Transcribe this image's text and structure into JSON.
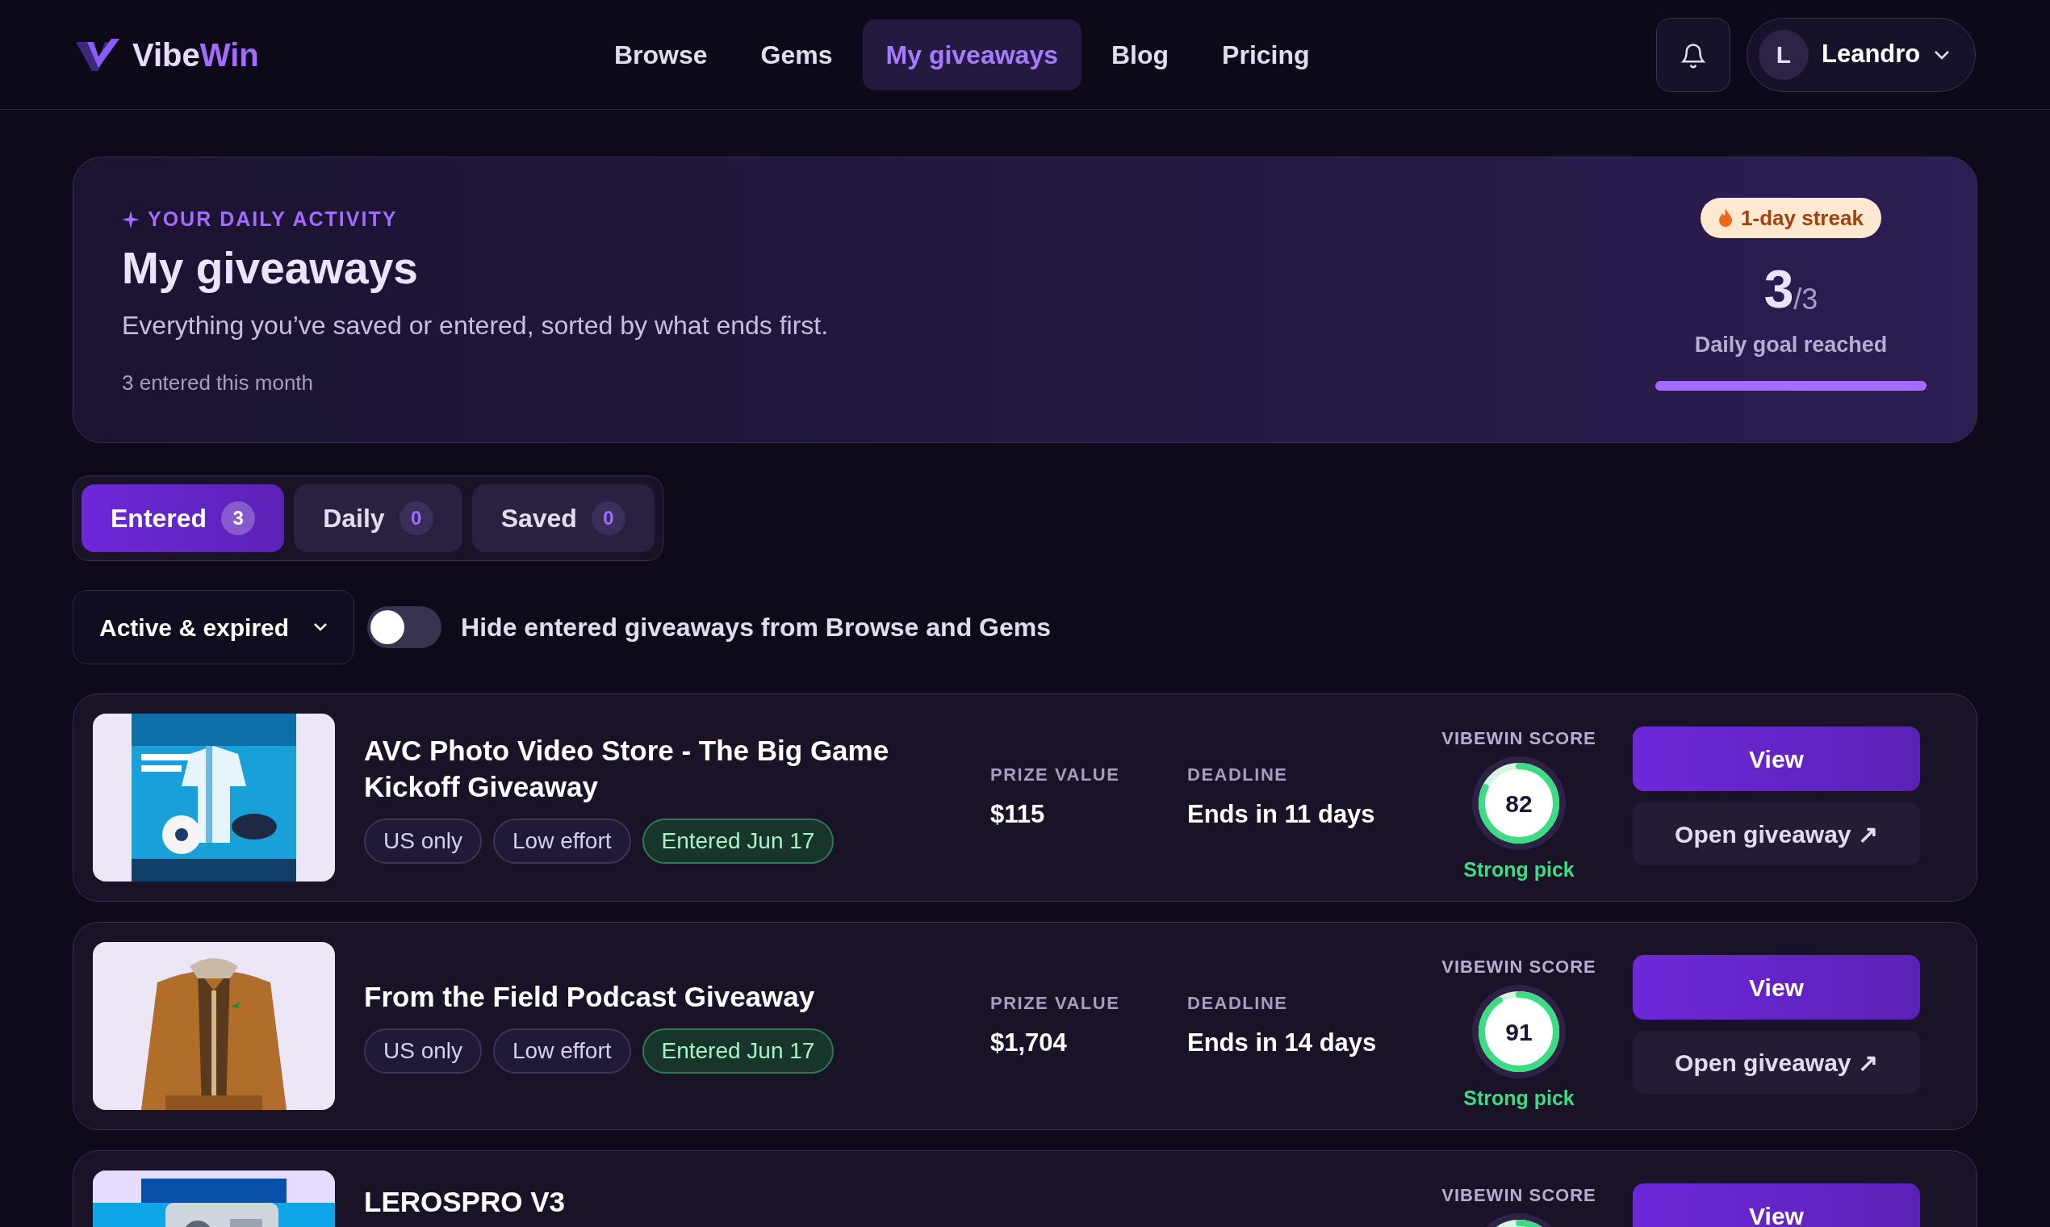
{
  "brand": {
    "part1": "Vibe",
    "part2": "Win"
  },
  "nav": [
    {
      "label": "Browse",
      "selected": false
    },
    {
      "label": "Gems",
      "selected": false
    },
    {
      "label": "My giveaways",
      "selected": true
    },
    {
      "label": "Blog",
      "selected": false
    },
    {
      "label": "Pricing",
      "selected": false
    }
  ],
  "user": {
    "initial": "L",
    "name": "Leandro"
  },
  "hero": {
    "eyebrow": "YOUR DAILY ACTIVITY",
    "title": "My giveaways",
    "subtitle": "Everything you’ve saved or entered, sorted by what ends first.",
    "note": "3 entered this month",
    "streak": "1-day streak",
    "goal_count": "3",
    "goal_total": "/3",
    "goal_label": "Daily goal reached",
    "level": 1
  },
  "tabs": [
    {
      "label": "Entered",
      "count": "3",
      "selected": true
    },
    {
      "label": "Daily",
      "count": "0",
      "selected": false
    },
    {
      "label": "Saved",
      "count": "0",
      "selected": false
    }
  ],
  "filter": {
    "value": "Active & expired"
  },
  "hide_toggle": {
    "on": false,
    "label": "Hide entered giveaways from Browse and Gems"
  },
  "giveaways": [
    {
      "title": "AVC Photo Video Store - The Big Game Kickoff Giveaway",
      "tags": [
        {
          "label": "US only",
          "kind": "plain"
        },
        {
          "label": "Low effort",
          "kind": "plain"
        },
        {
          "label": "Entered Jun 17",
          "kind": "entered"
        }
      ],
      "prize_label": "PRIZE VALUE",
      "prize": "$115",
      "deadline_label": "DEADLINE",
      "deadline": "Ends in 11 days",
      "score_label": "VIBEWIN SCORE",
      "score": "82",
      "level": 0.82,
      "verdict": "Strong pick",
      "view": "View",
      "open": "Open giveaway ↗",
      "kind": "picture"
    },
    {
      "title": "From the Field Podcast Giveaway",
      "tags": [
        {
          "label": "US only",
          "kind": "plain"
        },
        {
          "label": "Low effort",
          "kind": "plain"
        },
        {
          "label": "Entered Jun 17",
          "kind": "entered"
        }
      ],
      "prize_label": "PRIZE VALUE",
      "prize": "$1,704",
      "deadline_label": "DEADLINE",
      "deadline": "Ends in 14 days",
      "score_label": "VIBEWIN SCORE",
      "score": "91",
      "level": 0.91,
      "verdict": "Strong pick",
      "view": "View",
      "open": "Open giveaway ↗",
      "kind": "picture"
    },
    {
      "title": "LEROSPRO V3",
      "score_label": "VIBEWIN SCORE",
      "view": "View",
      "kind": "picture"
    }
  ]
}
